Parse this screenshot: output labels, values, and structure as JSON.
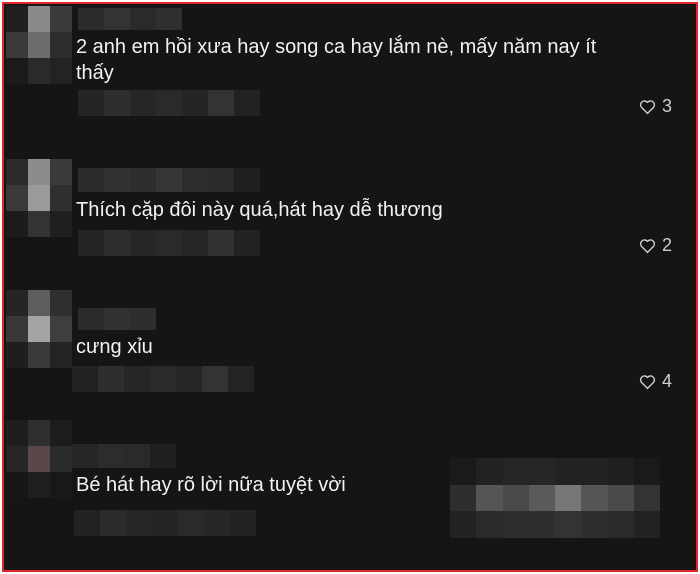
{
  "comments": [
    {
      "text": "2 anh em hồi xưa hay song ca hay lắm nè, mấy năm nay ít thấy",
      "likes": "3"
    },
    {
      "text": "Thích cặp đôi này quá,hát hay dễ thương",
      "likes": "2"
    },
    {
      "text": "cưng xỉu",
      "likes": "4"
    },
    {
      "text": "Bé hát hay rõ lời nữa tuyệt vời",
      "likes": ""
    }
  ],
  "icons": {
    "like": "heart-outline-icon"
  }
}
